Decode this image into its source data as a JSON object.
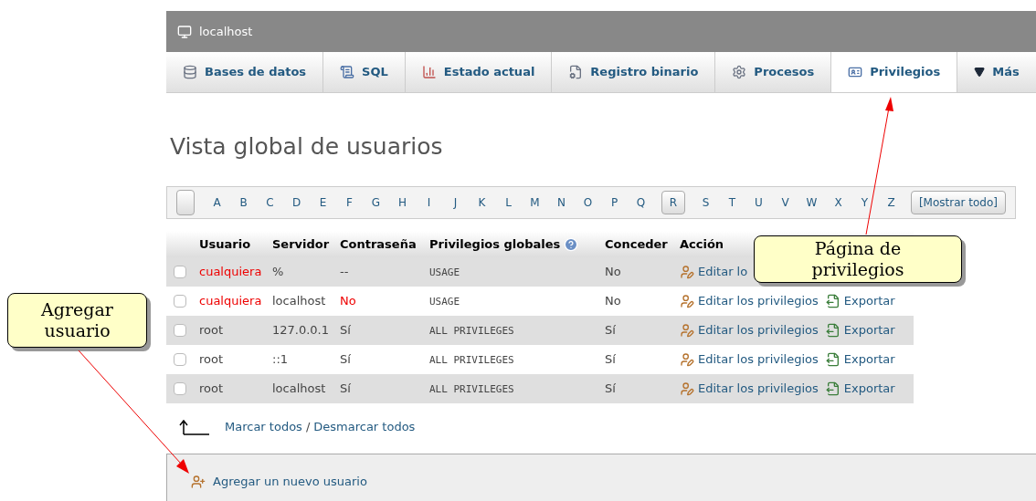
{
  "window": {
    "title": "localhost"
  },
  "tabs": [
    {
      "label": "Bases de datos",
      "selected": false
    },
    {
      "label": "SQL",
      "selected": false
    },
    {
      "label": "Estado actual",
      "selected": false
    },
    {
      "label": "Registro binario",
      "selected": false
    },
    {
      "label": "Procesos",
      "selected": false
    },
    {
      "label": "Privilegios",
      "selected": true
    },
    {
      "label": "Más",
      "selected": false
    }
  ],
  "heading": "Vista global de usuarios",
  "letters": [
    {
      "label": "A",
      "selected": false
    },
    {
      "label": "B",
      "selected": false
    },
    {
      "label": "C",
      "selected": false
    },
    {
      "label": "D",
      "selected": false
    },
    {
      "label": "E",
      "selected": false
    },
    {
      "label": "F",
      "selected": false
    },
    {
      "label": "G",
      "selected": false
    },
    {
      "label": "H",
      "selected": false
    },
    {
      "label": "I",
      "selected": false
    },
    {
      "label": "J",
      "selected": false
    },
    {
      "label": "K",
      "selected": false
    },
    {
      "label": "L",
      "selected": false
    },
    {
      "label": "M",
      "selected": false
    },
    {
      "label": "N",
      "selected": false
    },
    {
      "label": "O",
      "selected": false
    },
    {
      "label": "P",
      "selected": false
    },
    {
      "label": "Q",
      "selected": false
    },
    {
      "label": "R",
      "selected": true
    },
    {
      "label": "S",
      "selected": false
    },
    {
      "label": "T",
      "selected": false
    },
    {
      "label": "U",
      "selected": false
    },
    {
      "label": "V",
      "selected": false
    },
    {
      "label": "W",
      "selected": false
    },
    {
      "label": "X",
      "selected": false
    },
    {
      "label": "Y",
      "selected": false
    },
    {
      "label": "Z",
      "selected": false
    }
  ],
  "show_all": "[Mostrar todo]",
  "table": {
    "columns": [
      "Usuario",
      "Servidor",
      "Contraseña",
      "Privilegios globales",
      "Conceder",
      "Acción"
    ],
    "rows": [
      {
        "checked": false,
        "user": "cualquiera",
        "user_warning": true,
        "host": "%",
        "password": "--",
        "password_warning": false,
        "privileges": "USAGE",
        "grant": "No",
        "edit": "Editar lo"
      },
      {
        "checked": false,
        "user": "cualquiera",
        "user_warning": true,
        "host": "localhost",
        "password": "No",
        "password_warning": true,
        "privileges": "USAGE",
        "grant": "No",
        "edit": "Editar los privilegios",
        "export": "Exportar"
      },
      {
        "checked": false,
        "user": "root",
        "user_warning": false,
        "host": "127.0.0.1",
        "password": "Sí",
        "password_warning": false,
        "privileges": "ALL PRIVILEGES",
        "grant": "Sí",
        "edit": "Editar los privilegios",
        "export": "Exportar"
      },
      {
        "checked": false,
        "user": "root",
        "user_warning": false,
        "host": "::1",
        "password": "Sí",
        "password_warning": false,
        "privileges": "ALL PRIVILEGES",
        "grant": "Sí",
        "edit": "Editar los privilegios",
        "export": "Exportar"
      },
      {
        "checked": false,
        "user": "root",
        "user_warning": false,
        "host": "localhost",
        "password": "Sí",
        "password_warning": false,
        "privileges": "ALL PRIVILEGES",
        "grant": "Sí",
        "edit": "Editar los privilegios",
        "export": "Exportar"
      }
    ]
  },
  "mark_all": "Marcar todos",
  "separator": "/",
  "unmark_all": "Desmarcar todos",
  "add_user": "Agregar un nuevo usuario",
  "callouts": [
    {
      "text": "Página de privilegios",
      "kind": "right"
    },
    {
      "text": "Agregar usuario",
      "kind": "left"
    }
  ]
}
